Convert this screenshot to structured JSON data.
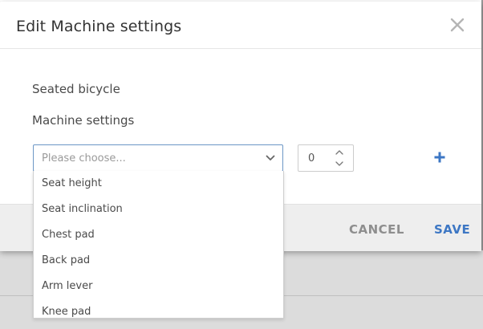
{
  "dialog": {
    "title": "Edit Machine settings",
    "machine_name": "Seated bicycle",
    "section_label": "Machine settings",
    "setting_select": {
      "placeholder": "Please choose...",
      "options": [
        "Seat height",
        "Seat inclination",
        "Chest pad",
        "Back pad",
        "Arm lever",
        "Knee pad"
      ]
    },
    "value_input": {
      "value": "0"
    },
    "footer": {
      "cancel_label": "CANCEL",
      "save_label": "SAVE"
    }
  },
  "colors": {
    "accent": "#3d77c4",
    "select_border": "#6c97c6",
    "footer_bg": "#eeeeee",
    "backdrop": "#dcdcdc"
  },
  "icons": {
    "close": "close-icon",
    "chevron": "chevron-down-icon",
    "spin_up": "spin-up-icon",
    "spin_down": "spin-down-icon",
    "add": "plus-icon"
  }
}
